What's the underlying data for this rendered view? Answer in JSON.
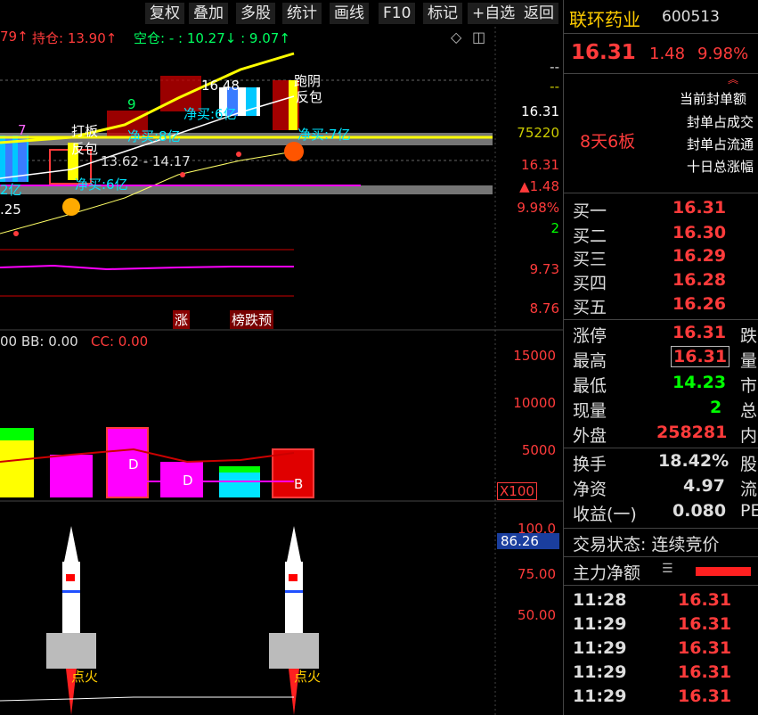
{
  "menu": [
    "复权",
    "叠加",
    "多股",
    "统计",
    "画线",
    "F10",
    "标记",
    "+自选",
    "返回"
  ],
  "header_indicators": {
    "prefix": "79↑",
    "hold": "持仓: 13.90↑",
    "empty": "空仓: - : 10.27↓ : 9.07↑"
  },
  "price_axis": [
    "16.31",
    "75220",
    "16.31",
    "▲1.48",
    "9.98%",
    "2",
    "9.73",
    "8.76"
  ],
  "volume_axis": [
    "15000",
    "10000",
    "5000"
  ],
  "volume_scale": "X100",
  "bottom_axis": [
    "100.0",
    "86.26",
    "75.00",
    "50.00"
  ],
  "chart_annotations": {
    "a1": "16.48",
    "a2": "净买:6亿",
    "a3": "9",
    "a4": "净买:8亿",
    "a5": "打板",
    "a6": "反包",
    "a7": "7",
    "a8": "13.62 - 14.17",
    "a9": "净买:6亿",
    "a10": "2亿",
    "a11": ".25",
    "a12": "净买:7亿",
    "a13": "反包",
    "a14": "跑阴",
    "tag_up": "涨",
    "tag_rank": "榜跌预",
    "bb": "00  BB: 0.00",
    "cc": "CC: 0.00",
    "bar_d1": "D",
    "bar_d2": "D",
    "bar_b": "B",
    "ignite1": "点火",
    "ignite2": "点火"
  },
  "stock": {
    "name": "联环药业",
    "code": "600513",
    "price": "16.31",
    "change": "1.48",
    "pct": "9.98%"
  },
  "limit_info": {
    "streak": "8天6板",
    "lines": [
      "当前封单额",
      "封单占成交",
      "封单占流通",
      "十日总涨幅"
    ]
  },
  "order_book": [
    {
      "label": "买一",
      "price": "16.31"
    },
    {
      "label": "买二",
      "price": "16.30"
    },
    {
      "label": "买三",
      "price": "16.29"
    },
    {
      "label": "买四",
      "price": "16.28"
    },
    {
      "label": "买五",
      "price": "16.26"
    }
  ],
  "quote": [
    {
      "label": "涨停",
      "value": "16.31",
      "side": "跌"
    },
    {
      "label": "最高",
      "value": "16.31",
      "side": "量"
    },
    {
      "label": "最低",
      "value": "14.23",
      "side": "市"
    },
    {
      "label": "现量",
      "value": "2",
      "side": "总"
    },
    {
      "label": "外盘",
      "value": "258281",
      "side": "内"
    }
  ],
  "quote2": [
    {
      "label": "换手",
      "value": "18.42%",
      "side": "股"
    },
    {
      "label": "净资",
      "value": "4.97",
      "side": "流"
    },
    {
      "label": "收益(一)",
      "value": "0.080",
      "side": "PE"
    }
  ],
  "trade_status": "交易状态: 连续竞价",
  "main_flow": "主力净额",
  "ticks": [
    {
      "time": "11:28",
      "price": "16.31"
    },
    {
      "time": "11:29",
      "price": "16.31"
    },
    {
      "time": "11:29",
      "price": "16.31"
    },
    {
      "time": "11:29",
      "price": "16.31"
    },
    {
      "time": "11:29",
      "price": "16.31"
    }
  ],
  "colors": {
    "up": "#ff3b3b",
    "down": "#00e000",
    "yellow": "#ffff00",
    "cyan": "#00e5ff",
    "magenta": "#ff00ff"
  }
}
